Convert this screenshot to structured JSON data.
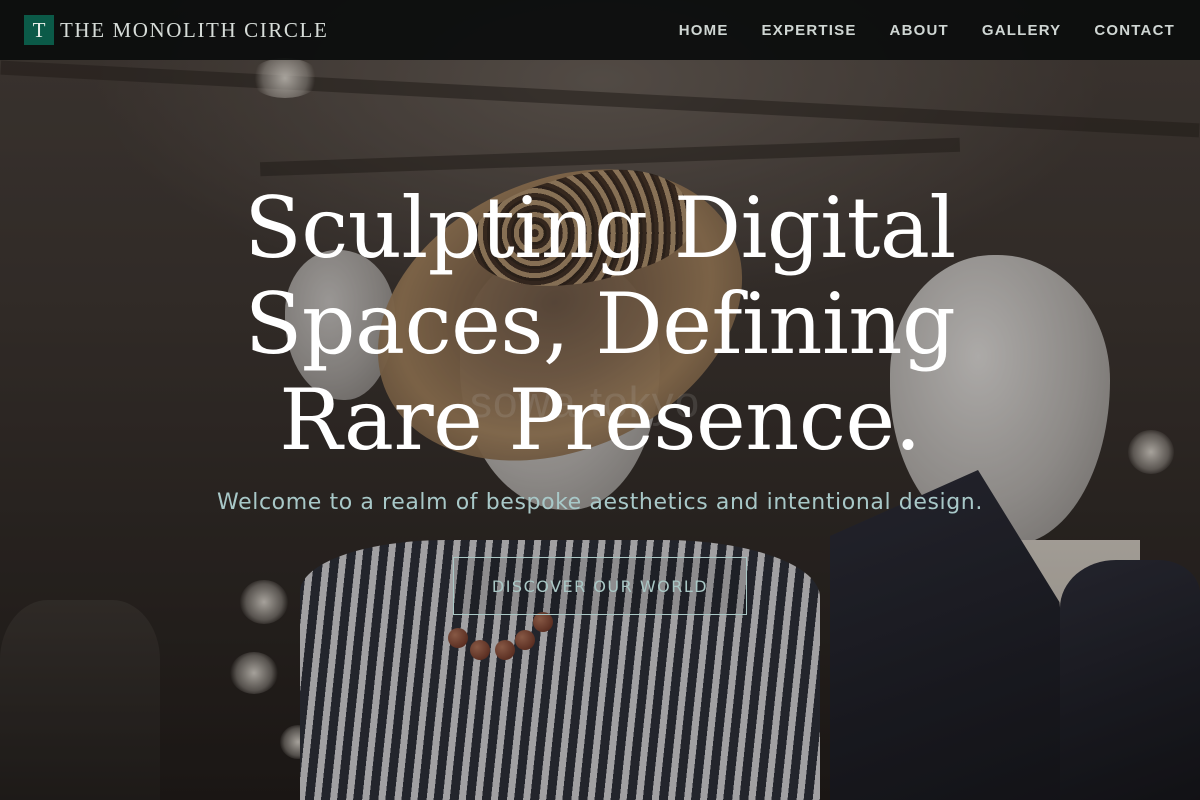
{
  "header": {
    "brand_mark": "T",
    "brand_name": "THE MONOLITH CIRCLE",
    "nav": [
      {
        "label": "HOME"
      },
      {
        "label": "EXPERTISE"
      },
      {
        "label": "ABOUT"
      },
      {
        "label": "GALLERY"
      },
      {
        "label": "CONTACT"
      }
    ]
  },
  "hero": {
    "title_lines": [
      "Sculpting Digital",
      "Spaces, Defining",
      "Rare Presence."
    ],
    "subtitle": "Welcome to a realm of bespoke aesthetics and intentional design.",
    "cta_label": "DISCOVER OUR WORLD",
    "background_watermark": "sowa tokyo"
  },
  "colors": {
    "brand_mark_bg": "#0b5a48",
    "accent_text": "#a8c8c8",
    "header_bg": "#0a0c0c"
  }
}
